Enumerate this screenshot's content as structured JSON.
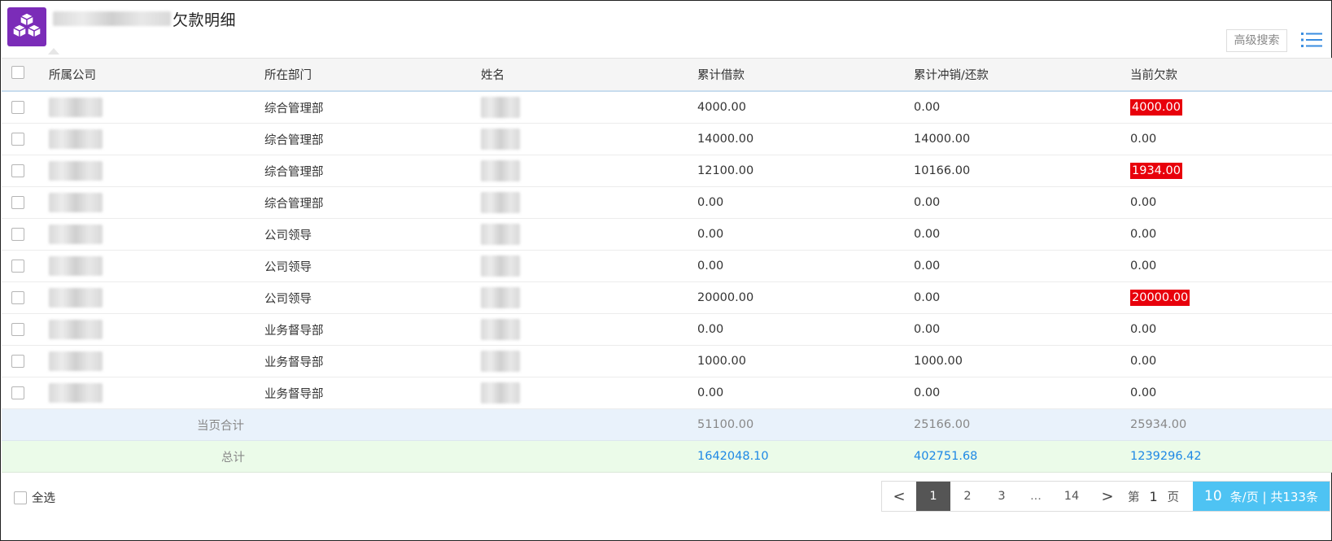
{
  "header": {
    "title": "欠款明细",
    "advanced_search_label": "高级搜索",
    "logo_icon": "cubes-icon",
    "list_icon": "list-icon"
  },
  "table": {
    "columns": [
      "所属公司",
      "所在部门",
      "姓名",
      "累计借款",
      "累计冲销/还款",
      "当前欠款"
    ],
    "rows": [
      {
        "dept": "综合管理部",
        "borrow": "4000.00",
        "repaid": "0.00",
        "owed": "4000.00",
        "highlight": true
      },
      {
        "dept": "综合管理部",
        "borrow": "14000.00",
        "repaid": "14000.00",
        "owed": "0.00",
        "highlight": false
      },
      {
        "dept": "综合管理部",
        "borrow": "12100.00",
        "repaid": "10166.00",
        "owed": "1934.00",
        "highlight": true
      },
      {
        "dept": "综合管理部",
        "borrow": "0.00",
        "repaid": "0.00",
        "owed": "0.00",
        "highlight": false
      },
      {
        "dept": "公司领导",
        "borrow": "0.00",
        "repaid": "0.00",
        "owed": "0.00",
        "highlight": false
      },
      {
        "dept": "公司领导",
        "borrow": "0.00",
        "repaid": "0.00",
        "owed": "0.00",
        "highlight": false
      },
      {
        "dept": "公司领导",
        "borrow": "20000.00",
        "repaid": "0.00",
        "owed": "20000.00",
        "highlight": true
      },
      {
        "dept": "业务督导部",
        "borrow": "0.00",
        "repaid": "0.00",
        "owed": "0.00",
        "highlight": false
      },
      {
        "dept": "业务督导部",
        "borrow": "1000.00",
        "repaid": "1000.00",
        "owed": "0.00",
        "highlight": false
      },
      {
        "dept": "业务督导部",
        "borrow": "0.00",
        "repaid": "0.00",
        "owed": "0.00",
        "highlight": false
      }
    ],
    "page_sum": {
      "label": "当页合计",
      "borrow": "51100.00",
      "repaid": "25166.00",
      "owed": "25934.00"
    },
    "grand_total": {
      "label": "总计",
      "borrow": "1642048.10",
      "repaid": "402751.68",
      "owed": "1239296.42"
    }
  },
  "footer": {
    "select_all_label": "全选",
    "pagination": {
      "prev": "<",
      "next": ">",
      "pages": [
        "1",
        "2",
        "3",
        "...",
        "14"
      ],
      "current": "1",
      "goto_prefix": "第",
      "goto_value": "1",
      "goto_suffix": "页",
      "page_size": "10",
      "page_size_label": "条/页 | 共133条"
    }
  },
  "colors": {
    "logo": "#7b2cb8",
    "highlight_red": "#e8000b",
    "sum_row_bg": "#e9f2fb",
    "total_row_bg": "#ebfbe9",
    "total_text": "#1e88e5",
    "page_size_bg": "#4ec3f3",
    "active_page_bg": "#555555"
  }
}
